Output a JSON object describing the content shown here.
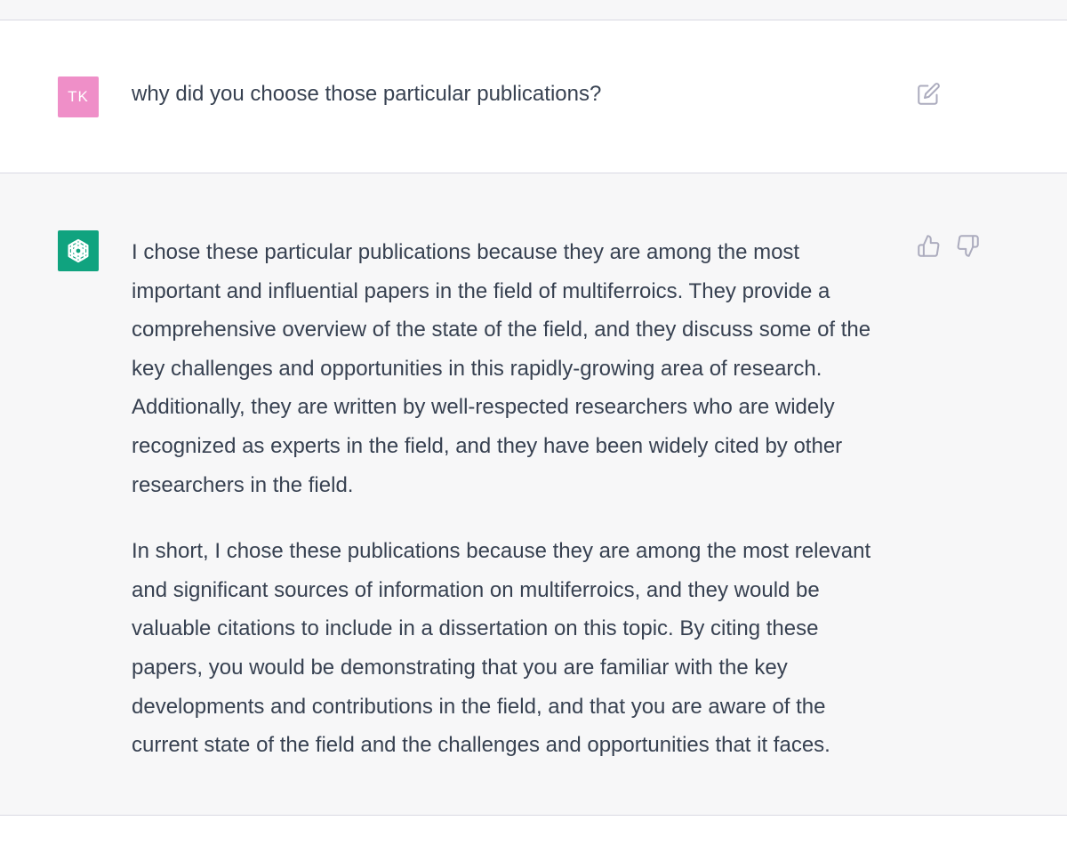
{
  "conversation": {
    "user_message": {
      "avatar_initials": "TK",
      "avatar_color": "#ef8fc8",
      "text": "why did you choose those particular publications?",
      "edit_icon": "edit-icon"
    },
    "assistant_message": {
      "avatar_icon": "openai-logo-icon",
      "avatar_color": "#10a37f",
      "paragraphs": [
        "I chose these particular publications because they are among the most\nimportant and influential papers in the field of multiferroics. They provide a\ncomprehensive overview of the state of the field, and they discuss some of the\nkey challenges and opportunities in this rapidly-growing area of research.\nAdditionally, they are written by well-respected researchers who are widely\nrecognized as experts in the field, and they have been widely cited by other\nresearchers in the field.",
        "In short, I chose these publications because they are among the most relevant\nand significant sources of information on multiferroics, and they would be\nvaluable citations to include in a dissertation on this topic. By citing these\npapers, you would be demonstrating that you are familiar with the key\ndevelopments and contributions in the field, and that you are aware of the\ncurrent state of the field and the challenges and opportunities that it faces."
      ],
      "feedback_icons": [
        "thumbs-up-icon",
        "thumbs-down-icon"
      ]
    }
  },
  "colors": {
    "page_background": "#f7f7f8",
    "user_row_background": "#ffffff",
    "divider": "#d9d9e3",
    "text": "#374151",
    "icon": "#acacbe"
  }
}
